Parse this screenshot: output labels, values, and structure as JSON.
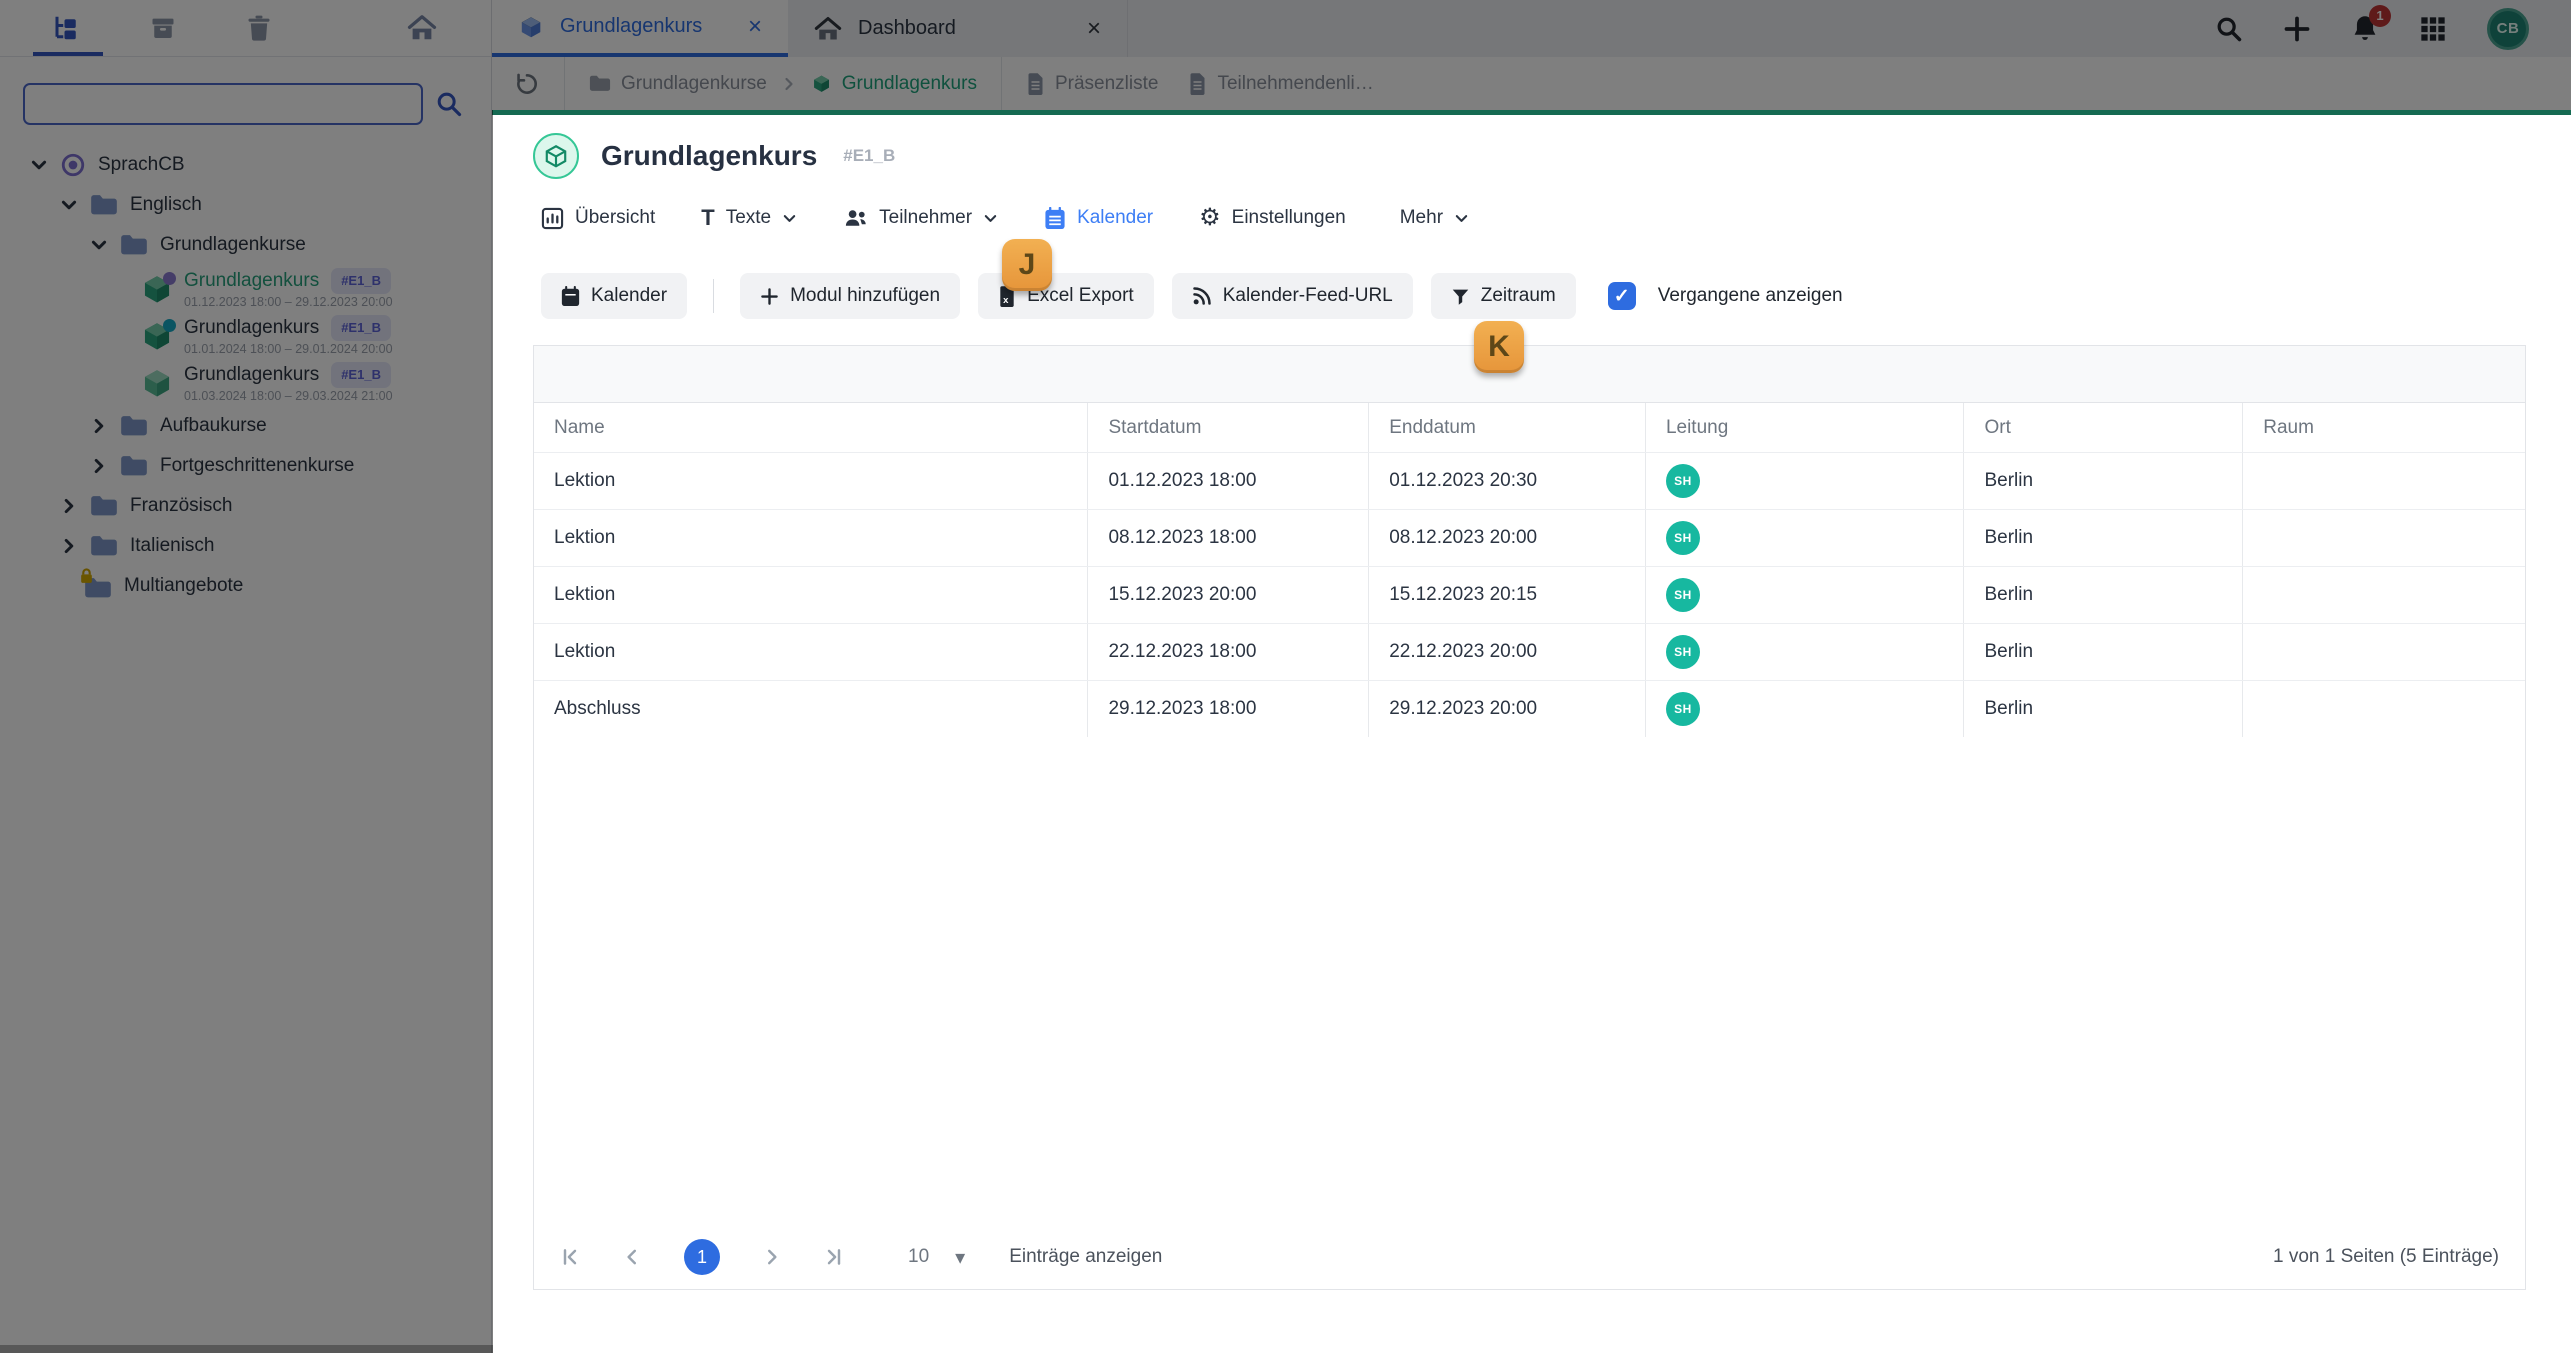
{
  "colors": {
    "accent_blue": "#2e6ce0",
    "accent_green": "#1ea37c",
    "content_topbar_green": "#156a52",
    "avatar_teal": "#17b8a0",
    "marker_orange": "#e8a042",
    "notification_red": "#bf3434"
  },
  "sidebar": {
    "search": {
      "value": ""
    },
    "tree": {
      "root_label": "SprachCB",
      "lang_en": "Englisch",
      "grundlagenkurse": "Grundlagenkurse",
      "courses": [
        {
          "title": "Grundlagenkurs",
          "badge": "#E1_B",
          "dates": "01.12.2023 18:00 – 29.12.2023 20:00"
        },
        {
          "title": "Grundlagenkurs",
          "badge": "#E1_B",
          "dates": "01.01.2024 18:00 – 29.01.2024 20:00"
        },
        {
          "title": "Grundlagenkurs",
          "badge": "#E1_B",
          "dates": "01.03.2024 18:00 – 29.03.2024 21:00"
        }
      ],
      "aufbaukurse": "Aufbaukurse",
      "fortgeschrittenenkurse": "Fortgeschrittenenkurse",
      "franzoesisch": "Französisch",
      "italienisch": "Italienisch",
      "multiangebote": "Multiangebote"
    }
  },
  "topbar": {
    "tabs": [
      {
        "label": "Grundlagenkurs"
      },
      {
        "label": "Dashboard"
      }
    ],
    "notification_count": "1",
    "user_initials": "CB"
  },
  "breadcrumb": {
    "folder": "Grundlagenkurse",
    "current": "Grundlagenkurs",
    "doc1": "Präsenzliste",
    "doc2": "Teilnehmendenli…"
  },
  "header": {
    "title": "Grundlagenkurs",
    "code": "#E1_B",
    "tabs": [
      {
        "label": "Übersicht"
      },
      {
        "label": "Texte"
      },
      {
        "label": "Teilnehmer"
      },
      {
        "label": "Kalender"
      },
      {
        "label": "Einstellungen"
      },
      {
        "label": "Mehr"
      }
    ],
    "active_tab": "Kalender"
  },
  "toolbar": {
    "buttons": [
      {
        "label": "Kalender"
      },
      {
        "label": "Modul hinzufügen"
      },
      {
        "label": "Excel Export"
      },
      {
        "label": "Kalender-Feed-URL"
      },
      {
        "label": "Zeitraum"
      }
    ],
    "checkbox_label": "Vergangene anzeigen",
    "checkbox_checked": true
  },
  "table": {
    "columns": [
      "Name",
      "Startdatum",
      "Enddatum",
      "Leitung",
      "Ort",
      "Raum"
    ],
    "rows": [
      {
        "name": "Lektion",
        "start": "01.12.2023 18:00",
        "end": "01.12.2023 20:30",
        "leitung": "SH",
        "ort": "Berlin",
        "raum": ""
      },
      {
        "name": "Lektion",
        "start": "08.12.2023 18:00",
        "end": "08.12.2023 20:00",
        "leitung": "SH",
        "ort": "Berlin",
        "raum": ""
      },
      {
        "name": "Lektion",
        "start": "15.12.2023 20:00",
        "end": "15.12.2023 20:15",
        "leitung": "SH",
        "ort": "Berlin",
        "raum": ""
      },
      {
        "name": "Lektion",
        "start": "22.12.2023 18:00",
        "end": "22.12.2023 20:00",
        "leitung": "SH",
        "ort": "Berlin",
        "raum": ""
      },
      {
        "name": "Abschluss",
        "start": "29.12.2023 18:00",
        "end": "29.12.2023 20:00",
        "leitung": "SH",
        "ort": "Berlin",
        "raum": ""
      }
    ]
  },
  "pagination": {
    "page": "1",
    "page_size": "10",
    "entries_label": "Einträge anzeigen",
    "summary": "1 von 1 Seiten (5 Einträge)"
  },
  "markers": {
    "j": "J",
    "k": "K"
  },
  "icons": {
    "sidebar": [
      "tree-view-icon",
      "archive-icon",
      "trash-icon",
      "home-icon",
      "search-icon"
    ],
    "topbar": [
      "search-icon",
      "plus-icon",
      "bell-icon",
      "grid-icon"
    ],
    "breadcrumb": [
      "history-icon",
      "folder-icon",
      "cube-icon",
      "document-icon"
    ],
    "page_tabs": [
      "chart-icon",
      "text-icon",
      "people-icon",
      "calendar-icon",
      "gear-icon"
    ],
    "toolbar": [
      "calendar-icon",
      "plus-icon",
      "excel-icon",
      "rss-icon",
      "funnel-icon"
    ]
  }
}
